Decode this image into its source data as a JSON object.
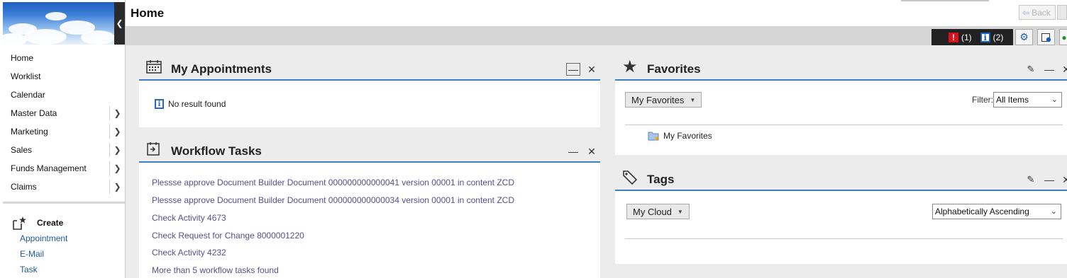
{
  "page": {
    "title": "Home"
  },
  "nav": {
    "items": [
      {
        "label": "Home",
        "has_submenu": false
      },
      {
        "label": "Worklist",
        "has_submenu": false
      },
      {
        "label": "Calendar",
        "has_submenu": false
      },
      {
        "label": "Master Data",
        "has_submenu": true
      },
      {
        "label": "Marketing",
        "has_submenu": true
      },
      {
        "label": "Sales",
        "has_submenu": true
      },
      {
        "label": "Funds Management",
        "has_submenu": true
      },
      {
        "label": "Claims",
        "has_submenu": true
      }
    ],
    "create": {
      "label": "Create",
      "links": [
        "Appointment",
        "E-Mail",
        "Task"
      ]
    }
  },
  "toolbar": {
    "back_label": "Back",
    "error_count": "(1)",
    "info_count": "(2)",
    "error_icon": "!",
    "info_icon": "i"
  },
  "appointments": {
    "title": "My Appointments",
    "empty_message": "No result found"
  },
  "workflow": {
    "title": "Workflow Tasks",
    "tasks": [
      "Plessse approve Document Builder Document 000000000000041 version 00001 in content ZCD",
      "Plessse approve Document Builder Document 000000000000034 version 00001 in content ZCD",
      "Check Activity 4673",
      "Check Request for Change 8000001220",
      "Check Activity 4232",
      "More than 5 workflow tasks found"
    ]
  },
  "favorites": {
    "title": "Favorites",
    "dropdown_label": "My Favorites",
    "filter_label": "Filter:",
    "filter_value": "All Items",
    "folder_label": "My Favorites"
  },
  "tags": {
    "title": "Tags",
    "dropdown_label": "My Cloud",
    "sort_value": "Alphabetically Ascending"
  },
  "colors": {
    "accent": "#3b7fc4",
    "link": "#1d5b9e",
    "task_link": "#5a4e8a",
    "error": "#d8131b"
  }
}
